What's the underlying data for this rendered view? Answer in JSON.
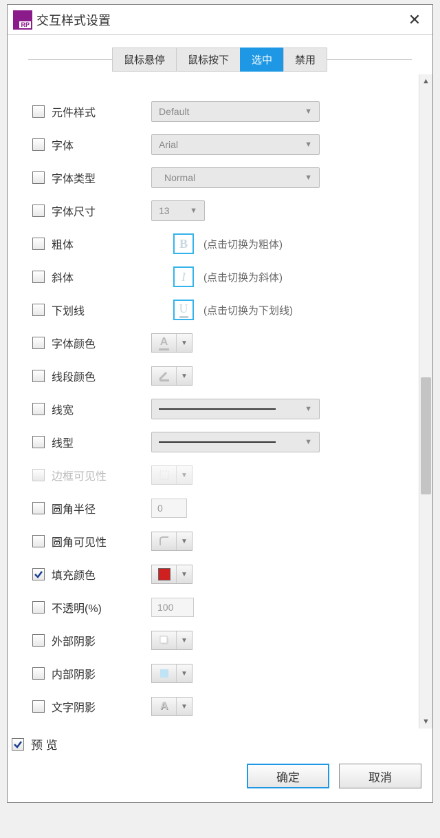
{
  "title": "交互样式设置",
  "tabs": {
    "hover": "鼠标悬停",
    "press": "鼠标按下",
    "selected": "选中",
    "disabled": "禁用"
  },
  "rows": {
    "widgetStyle": {
      "label": "元件样式",
      "value": "Default"
    },
    "font": {
      "label": "字体",
      "value": "Arial"
    },
    "fontType": {
      "label": "字体类型",
      "value": "Normal"
    },
    "fontSize": {
      "label": "字体尺寸",
      "value": "13"
    },
    "bold": {
      "label": "粗体",
      "hint": "(点击切换为粗体)",
      "glyph": "B"
    },
    "italic": {
      "label": "斜体",
      "hint": "(点击切换为斜体)",
      "glyph": "I"
    },
    "underline": {
      "label": "下划线",
      "hint": "(点击切换为下划线)",
      "glyph": "U"
    },
    "fontColor": {
      "label": "字体颜色",
      "glyph": "A"
    },
    "lineColor": {
      "label": "线段颜色"
    },
    "lineWidth": {
      "label": "线宽"
    },
    "lineStyle": {
      "label": "线型"
    },
    "borderVis": {
      "label": "边框可见性"
    },
    "cornerRadius": {
      "label": "圆角半径",
      "value": "0"
    },
    "cornerVis": {
      "label": "圆角可见性"
    },
    "fillColor": {
      "label": "填充颜色"
    },
    "opacity": {
      "label": "不透明(%)",
      "value": "100"
    },
    "outerShadow": {
      "label": "外部阴影"
    },
    "innerShadow": {
      "label": "内部阴影"
    },
    "textShadow": {
      "label": "文字阴影",
      "glyph": "A"
    }
  },
  "preview": {
    "label": "预 览"
  },
  "buttons": {
    "ok": "确定",
    "cancel": "取消"
  }
}
